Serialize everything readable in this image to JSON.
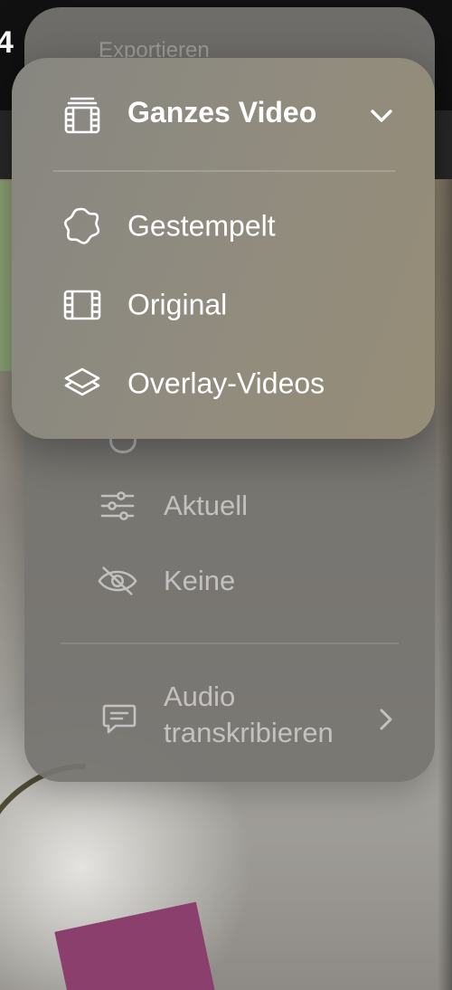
{
  "back_menu": {
    "title": "Exportieren",
    "items": [
      {
        "label": "Aktuell",
        "icon": "sliders-icon"
      },
      {
        "label": "Keine",
        "icon": "eye-slash-icon"
      }
    ],
    "audio": {
      "line1": "Audio",
      "line2": "transkribieren",
      "icon": "speech-bubble-icon"
    }
  },
  "front_menu": {
    "title": "Ganzes Video",
    "title_icon": "stacked-film-icon",
    "items": [
      {
        "label": "Gestempelt",
        "icon": "seal-icon"
      },
      {
        "label": "Original",
        "icon": "film-icon"
      },
      {
        "label": "Overlay-Videos",
        "icon": "layers-icon"
      }
    ]
  },
  "background": {
    "topbar_glyph": "4"
  }
}
